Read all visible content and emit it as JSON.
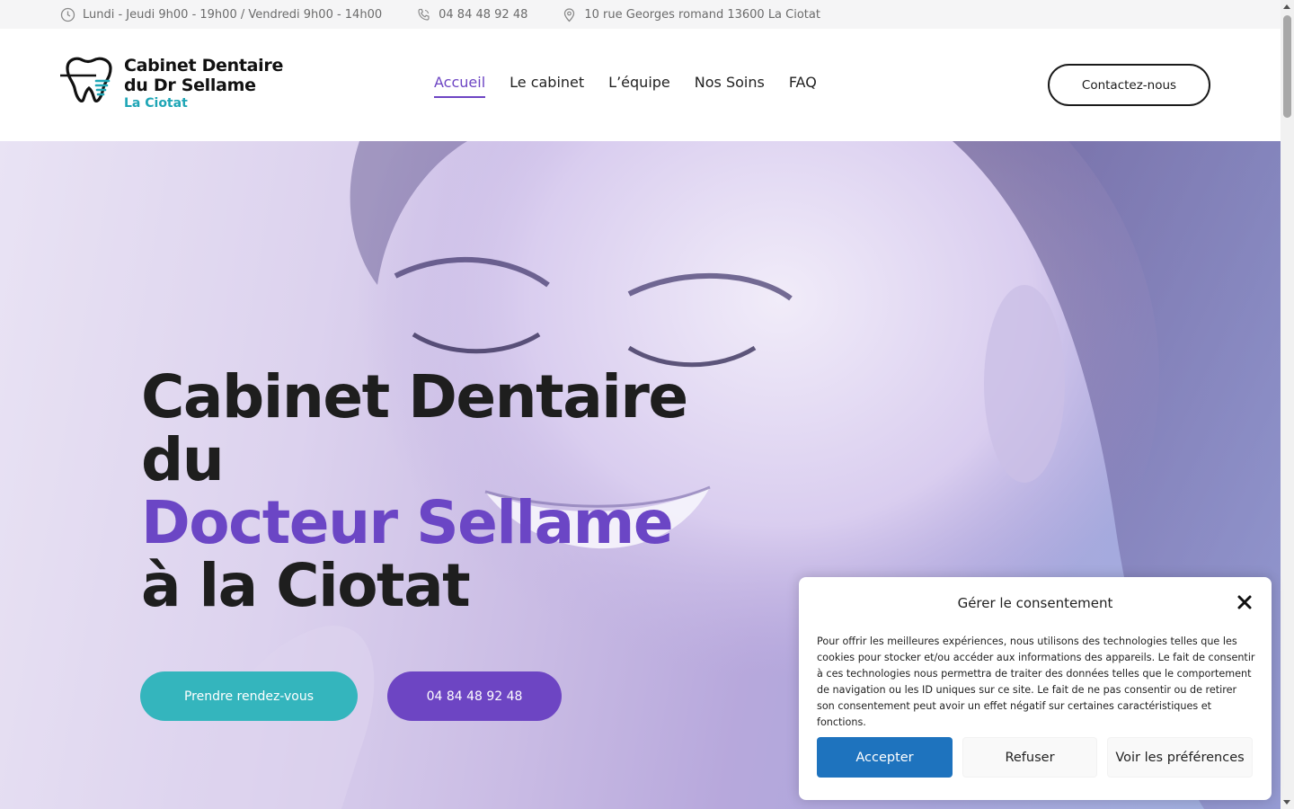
{
  "topbar": {
    "hours": "Lundi - Jeudi 9h00 - 19h00 / Vendredi 9h00 - 14h00",
    "phone": "04 84 48 92 48",
    "address": "10 rue Georges romand 13600 La Ciotat"
  },
  "logo": {
    "line1": "Cabinet Dentaire",
    "line2": "du Dr Sellame",
    "line3": "La Ciotat"
  },
  "nav": {
    "items": [
      {
        "label": "Accueil",
        "active": true
      },
      {
        "label": "Le cabinet"
      },
      {
        "label": "L’équipe"
      },
      {
        "label": "Nos Soins"
      },
      {
        "label": "FAQ"
      }
    ]
  },
  "header": {
    "contact_label": "Contactez-nous"
  },
  "hero": {
    "line1": "Cabinet Dentaire",
    "line2": "du",
    "line3": "Docteur Sellame",
    "line4": "à la Ciotat",
    "btn_appointment": "Prendre rendez-vous",
    "btn_phone": "04 84 48 92 48"
  },
  "consent": {
    "title": "Gérer le consentement",
    "text": "Pour offrir les meilleures expériences, nous utilisons des technologies telles que les cookies pour stocker et/ou accéder aux informations des appareils. Le fait de consentir à ces technologies nous permettra de traiter des données telles que le comportement de navigation ou les ID uniques sur ce site. Le fait de ne pas consentir ou de retirer son consentement peut avoir un effet négatif sur certaines caractéristiques et fonctions.",
    "accept": "Accepter",
    "refuse": "Refuser",
    "preferences": "Voir les préférences"
  },
  "colors": {
    "accent_purple": "#6d45c3",
    "accent_teal": "#34b5bd",
    "accept_blue": "#1e73be"
  }
}
